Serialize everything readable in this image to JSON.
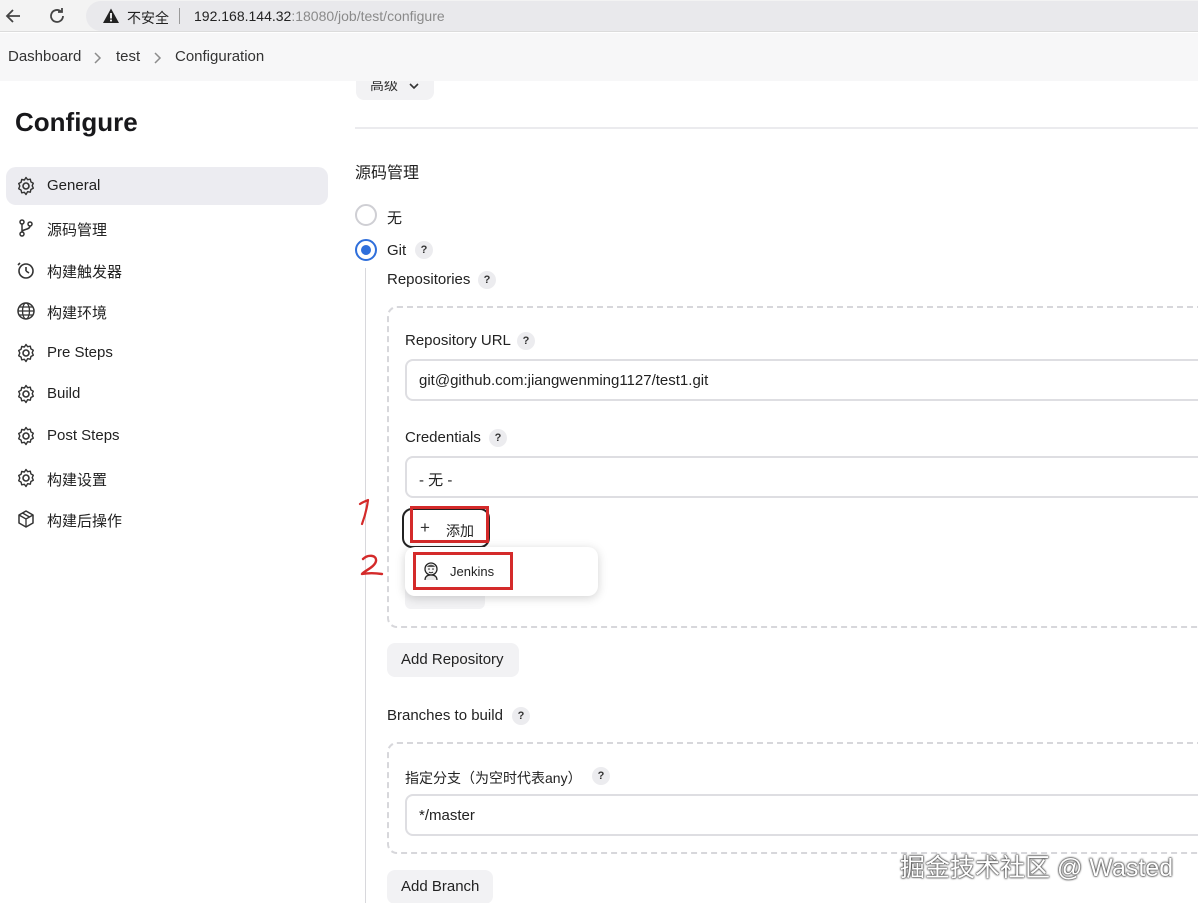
{
  "browser": {
    "insecure_label": "不安全",
    "url_host": "192.168.144.32",
    "url_rest": ":18080/job/test/configure"
  },
  "breadcrumb": {
    "items": [
      "Dashboard",
      "test",
      "Configuration"
    ]
  },
  "sidebar": {
    "title": "Configure",
    "items": [
      {
        "label": "General",
        "icon": "gear-icon",
        "active": true
      },
      {
        "label": "源码管理",
        "icon": "branch-icon"
      },
      {
        "label": "构建触发器",
        "icon": "timer-icon"
      },
      {
        "label": "构建环境",
        "icon": "globe-icon"
      },
      {
        "label": "Pre Steps",
        "icon": "gear-icon"
      },
      {
        "label": "Build",
        "icon": "gear-icon"
      },
      {
        "label": "Post Steps",
        "icon": "gear-icon"
      },
      {
        "label": "构建设置",
        "icon": "gear-icon"
      },
      {
        "label": "构建后操作",
        "icon": "package-icon"
      }
    ]
  },
  "main": {
    "advanced_label": "高级",
    "scm_title": "源码管理",
    "scm_options": {
      "none_label": "无",
      "git_label": "Git"
    },
    "help_glyph": "?",
    "repositories_label": "Repositories",
    "repository_url_label": "Repository URL",
    "repository_url_value": "git@github.com:jiangwenming1127/test1.git",
    "credentials_label": "Credentials",
    "credentials_value": "- 无 -",
    "add_button_label": "添加",
    "add_menu": {
      "items": [
        "Jenkins"
      ]
    },
    "add_repository_label": "Add Repository",
    "branches_label": "Branches to build",
    "branch_specifier_label": "指定分支（为空时代表any）",
    "branch_value": "*/master",
    "add_branch_label": "Add Branch"
  },
  "annotations": {
    "step1": "1",
    "step2": "2",
    "red_color": "#d42a2a"
  },
  "watermark": "掘金技术社区 @ Wasted",
  "colors": {
    "accent": "#2f6fdb",
    "sidebar_active": "#ececf1"
  }
}
